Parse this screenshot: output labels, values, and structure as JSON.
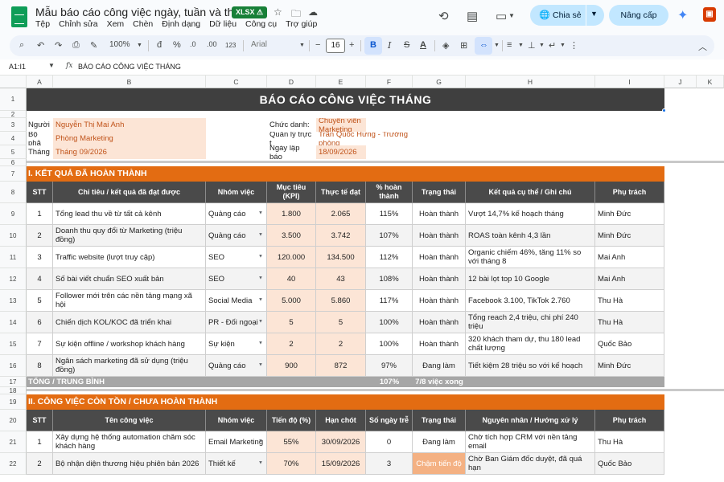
{
  "app": {
    "doc_title": "Mẫu báo cáo công việc ngày, tuần và tháng",
    "badge": "XLSX ⚠",
    "menu": [
      "Tệp",
      "Chỉnh sửa",
      "Xem",
      "Chèn",
      "Định dạng",
      "Dữ liệu",
      "Công cụ",
      "Trợ giúp"
    ],
    "share_label": "Chia sẻ",
    "upgrade_label": "Nâng cấp"
  },
  "toolbar": {
    "zoom": "100%",
    "currency": "đ",
    "percent": "%",
    "dec_decrease": ".0",
    "dec_increase": ".00",
    "number_format": "123",
    "font": "Arial",
    "font_size": "16"
  },
  "formula_bar": {
    "cell_ref": "A1:I1",
    "content": "BÁO CÁO CÔNG VIỆC THÁNG"
  },
  "grid": {
    "columns": [
      "A",
      "B",
      "C",
      "D",
      "E",
      "F",
      "G",
      "H",
      "I",
      "J",
      "K"
    ],
    "rows": [
      "1",
      "2",
      "3",
      "4",
      "5",
      "6",
      "7",
      "8",
      "9",
      "10",
      "11",
      "12",
      "13",
      "14",
      "15",
      "16",
      "17",
      "18",
      "19",
      "20",
      "21",
      "22"
    ]
  },
  "sheet": {
    "title": "BÁO CÁO CÔNG VIỆC THÁNG",
    "info_left": [
      {
        "label": "Người",
        "value": "Nguyễn Thị Mai Anh"
      },
      {
        "label": "Bộ phậ",
        "value": "Phòng Marketing"
      },
      {
        "label": "Tháng",
        "value": "Tháng 09/2026"
      }
    ],
    "info_right": [
      {
        "label": "Chức danh:",
        "value": "Chuyên viên Marketing"
      },
      {
        "label": "Quản lý trực t",
        "value": "Trần Quốc Hưng - Trưởng phòng"
      },
      {
        "label": "Ngày lập báo",
        "value": "18/09/2026"
      }
    ],
    "section1": {
      "heading": "I. KẾT QUẢ ĐÃ HOÀN THÀNH",
      "headers": [
        "STT",
        "Chỉ tiêu / kết quả đã đạt được",
        "Nhóm việc",
        "Mục tiêu (KPI)",
        "Thực tế đạt",
        "% hoàn thành",
        "Trạng thái",
        "Kết quả cụ thể / Ghi chú",
        "Phụ trách"
      ],
      "rows": [
        [
          "1",
          "Tổng lead thu về từ tất cả kênh",
          "Quảng cáo",
          "1.800",
          "2.065",
          "115%",
          "Hoàn thành",
          "Vượt 14,7% kế hoạch tháng",
          "Minh Đức"
        ],
        [
          "2",
          "Doanh thu quy đổi từ Marketing (triệu đồng)",
          "Quảng cáo",
          "3.500",
          "3.742",
          "107%",
          "Hoàn thành",
          "ROAS toàn kênh 4,3 lần",
          "Minh Đức"
        ],
        [
          "3",
          "Traffic website (lượt truy cập)",
          "SEO",
          "120.000",
          "134.500",
          "112%",
          "Hoàn thành",
          "Organic chiếm 46%, tăng 11% so với tháng 8",
          "Mai Anh"
        ],
        [
          "4",
          "Số bài viết chuẩn SEO xuất bản",
          "SEO",
          "40",
          "43",
          "108%",
          "Hoàn thành",
          "12 bài lọt top 10 Google",
          "Mai Anh"
        ],
        [
          "5",
          "Follower mới trên các nền tảng mạng xã hội",
          "Social Media",
          "5.000",
          "5.860",
          "117%",
          "Hoàn thành",
          "Facebook 3.100, TikTok 2.760",
          "Thu Hà"
        ],
        [
          "6",
          "Chiến dịch KOL/KOC đã triển khai",
          "PR - Đối ngoại",
          "5",
          "5",
          "100%",
          "Hoàn thành",
          "Tổng reach 2,4 triệu, chi phí 240 triệu",
          "Thu Hà"
        ],
        [
          "7",
          "Sự kiện offline / workshop khách hàng",
          "Sự kiện",
          "2",
          "2",
          "100%",
          "Hoàn thành",
          "320 khách tham dự, thu 180 lead chất lượng",
          "Quốc Bảo"
        ],
        [
          "8",
          "Ngân sách marketing đã sử dụng (triệu đồng)",
          "Quảng cáo",
          "900",
          "872",
          "97%",
          "Đang làm",
          "Tiết kiệm 28 triệu so với kế hoạch",
          "Minh Đức"
        ]
      ],
      "total_label": "TỔNG / TRUNG BÌNH",
      "total_percent": "107%",
      "total_status": "7/8 việc xong"
    },
    "section2": {
      "heading": "II. CÔNG VIỆC CÒN TỒN / CHƯA HOÀN THÀNH",
      "headers": [
        "STT",
        "Tên công việc",
        "Nhóm việc",
        "Tiến độ (%)",
        "Hạn chót",
        "Số ngày trễ",
        "Trạng thái",
        "Nguyên nhân / Hướng xử lý",
        "Phụ trách"
      ],
      "rows": [
        [
          "1",
          "Xây dựng hệ thống automation chăm sóc khách hàng",
          "Email Marketing",
          "55%",
          "30/09/2026",
          "0",
          "Đang làm",
          "Chờ tích hợp CRM với nền tảng email",
          "Thu Hà"
        ],
        [
          "2",
          "Bộ nhận diện thương hiệu phiên bản 2026",
          "Thiết kế",
          "70%",
          "15/09/2026",
          "3",
          "Chậm tiến độ",
          "Chờ Ban Giám đốc duyệt, đã quá hạn",
          "Quốc Bảo"
        ]
      ]
    }
  },
  "colors": {
    "orange": "#e36c12",
    "dark_header": "#4a4a4a",
    "peach": "#fce5d6",
    "selection": "#1a73e8"
  }
}
